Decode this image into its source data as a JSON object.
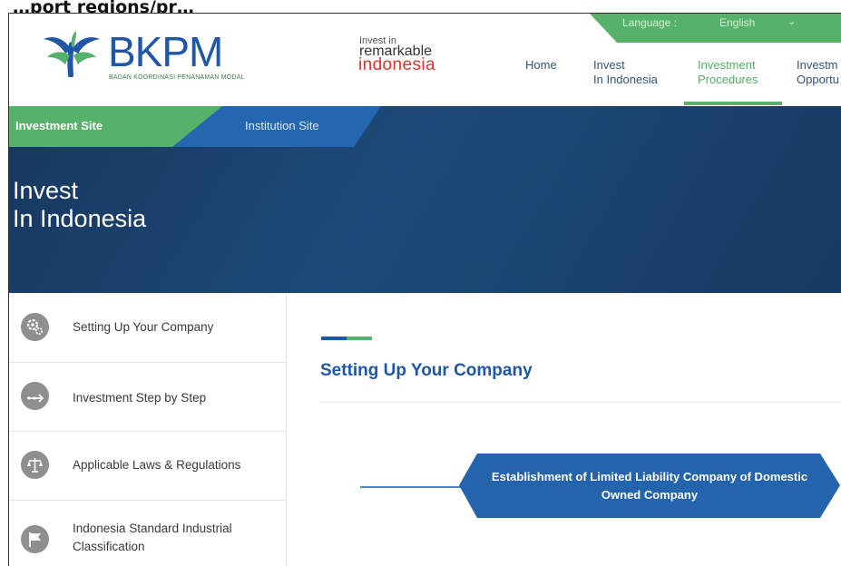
{
  "caption": "…port regions/pr…",
  "header": {
    "language_label": "Language :",
    "language_value": "English",
    "language_arrow": "⌄",
    "logo": {
      "name": "BKPM",
      "subtitle": "BADAN KOORDINASI PENANAMAN MODAL"
    },
    "tagline": {
      "line1": "Invest in",
      "line2": "remarkable",
      "line3": "indonesia"
    },
    "nav": [
      {
        "line1": "Home",
        "line2": ""
      },
      {
        "line1": "Invest",
        "line2": "In Indonesia"
      },
      {
        "line1": "Investment",
        "line2": "Procedures"
      },
      {
        "line1": "Investm",
        "line2": "Opportu"
      }
    ]
  },
  "banner": {
    "tab_investment": "Investment Site",
    "tab_institution": "Institution Site",
    "title_line1": "Invest",
    "title_line2": "In Indonesia"
  },
  "sidebar": {
    "items": [
      {
        "line1": "Setting Up Your Company",
        "line2": "",
        "icon": "gears-icon"
      },
      {
        "line1": "Investment Step by Step",
        "line2": "",
        "icon": "steps-icon"
      },
      {
        "line1": "Applicable Laws & Regulations",
        "line2": "",
        "icon": "scales-icon"
      },
      {
        "line1": "Indonesia Standard Industrial",
        "line2": "Classification",
        "icon": "flag-icon"
      }
    ]
  },
  "main": {
    "title": "Setting Up Your Company",
    "flow_box": "Establishment of Limited Liability Company of Domestic Owned Company"
  },
  "colors": {
    "brand_blue": "#1f56a5",
    "brand_green": "#56b16a",
    "banner_dark": "#17385f",
    "logo_red": "#e0302c"
  }
}
